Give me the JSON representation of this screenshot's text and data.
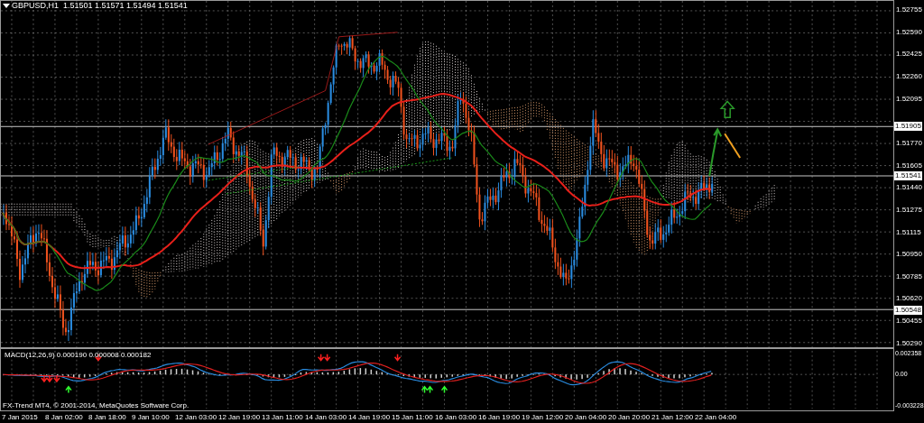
{
  "chart": {
    "title": "GBPUSD,H1  1.51501 1.51571 1.51494 1.51541",
    "copyright": "FX-Trend MT4, © 2001-2014, MetaQuotes Software Corp."
  },
  "price_axis": {
    "labels": [
      "1.52755",
      "1.52590",
      "1.52425",
      "1.52260",
      "1.52095",
      "1.51770",
      "1.51605",
      "1.51440",
      "1.51275",
      "1.51115",
      "1.50950",
      "1.50785",
      "1.50620",
      "1.50455",
      "1.50290"
    ],
    "markers": [
      "1.51905",
      "1.51541",
      "1.50548"
    ]
  },
  "macd": {
    "title": "MACD(12,26,9) 0.000190 0.000008 0.000182",
    "axis_labels": [
      "0.002358",
      "0.00",
      "-0.003228"
    ]
  },
  "time_axis": {
    "labels": [
      "7 Jan 2015",
      "8 Jan 02:00",
      "8 Jan 18:00",
      "9 Jan 10:00",
      "12 Jan 03:00",
      "12 Jan 19:00",
      "13 Jan 11:00",
      "14 Jan 03:00",
      "14 Jan 19:00",
      "15 Jan 11:00",
      "16 Jan 03:00",
      "16 Jan 19:00",
      "19 Jan 12:00",
      "20 Jan 04:00",
      "20 Jan 20:00",
      "21 Jan 12:00",
      "22 Jan 04:00"
    ]
  }
}
